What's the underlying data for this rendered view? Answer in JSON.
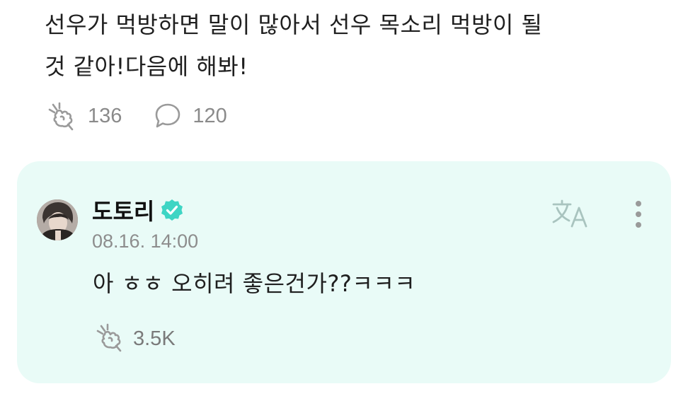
{
  "post": {
    "text_line1": "선우가 먹방하면 말이 많아서 선우 목소리 먹방이 될",
    "text_line2": "것 같아!다음에 해봐!",
    "like_count": "136",
    "comment_count": "120"
  },
  "reply": {
    "author": "도토리",
    "timestamp": "08.16. 14:00",
    "text": "아 ㅎㅎ 오히려 좋은건가??ㅋㅋㅋ",
    "like_count": "3.5K"
  },
  "colors": {
    "card_background": "#e9fbf7",
    "verified_badge": "#3ed5c4",
    "icon_gray": "#9a9a9a",
    "translate_icon": "#a9c4bf"
  },
  "icons": {
    "like": "cheer-hand-icon",
    "comment": "speech-bubble-icon",
    "verified": "verified-check-icon",
    "translate": "translate-icon",
    "more": "more-vertical-icon"
  }
}
